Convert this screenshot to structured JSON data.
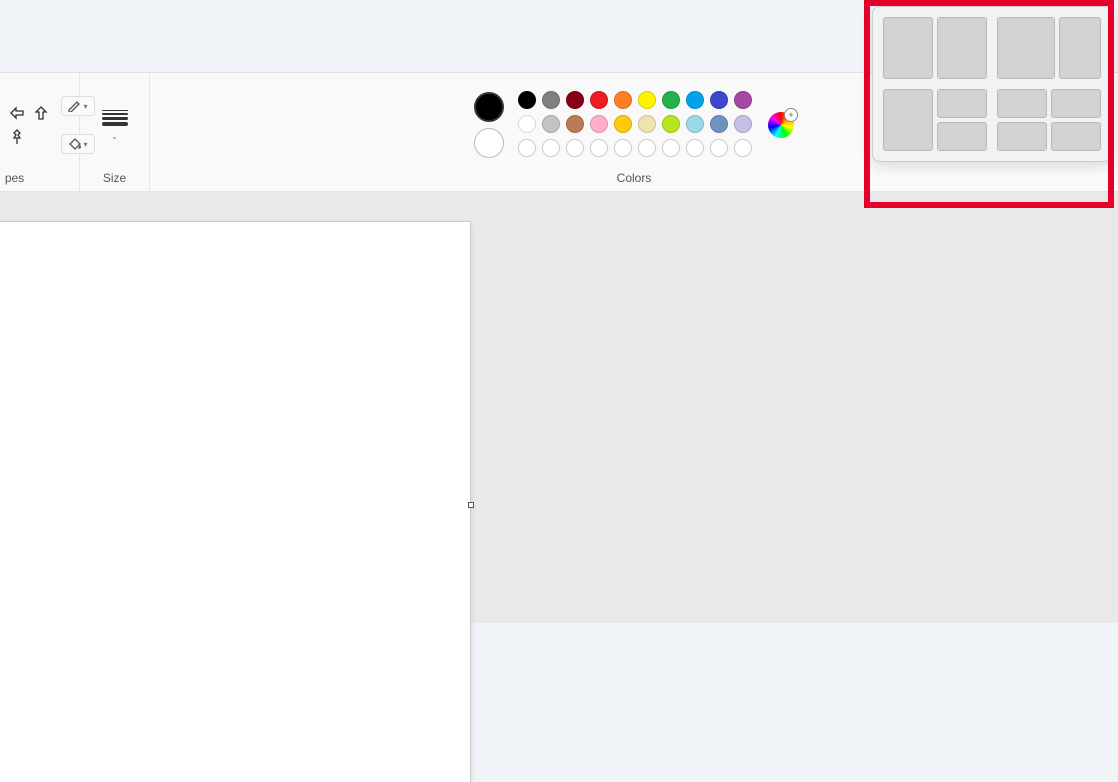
{
  "ribbon": {
    "shapes_label": "pes",
    "size_label": "Size",
    "colors_label": "Colors"
  },
  "colors": {
    "primary": "#000000",
    "secondary": "#ffffff",
    "row1": [
      "#000000",
      "#7f7f7f",
      "#880015",
      "#ed1c24",
      "#ff7f27",
      "#fff200",
      "#22b14c",
      "#00a2e8",
      "#3f48cc",
      "#a349a4"
    ],
    "row2": [
      "#ffffff",
      "#c3c3c3",
      "#b97a57",
      "#ffaec9",
      "#ffc90e",
      "#efe4b0",
      "#b5e61d",
      "#99d9ea",
      "#7092be",
      "#c8bfe7"
    ],
    "custom_empty_count": 10
  },
  "snap_layouts": {
    "options": [
      "two-equal",
      "two-left-wide",
      "one-plus-two",
      "four-equal"
    ]
  }
}
